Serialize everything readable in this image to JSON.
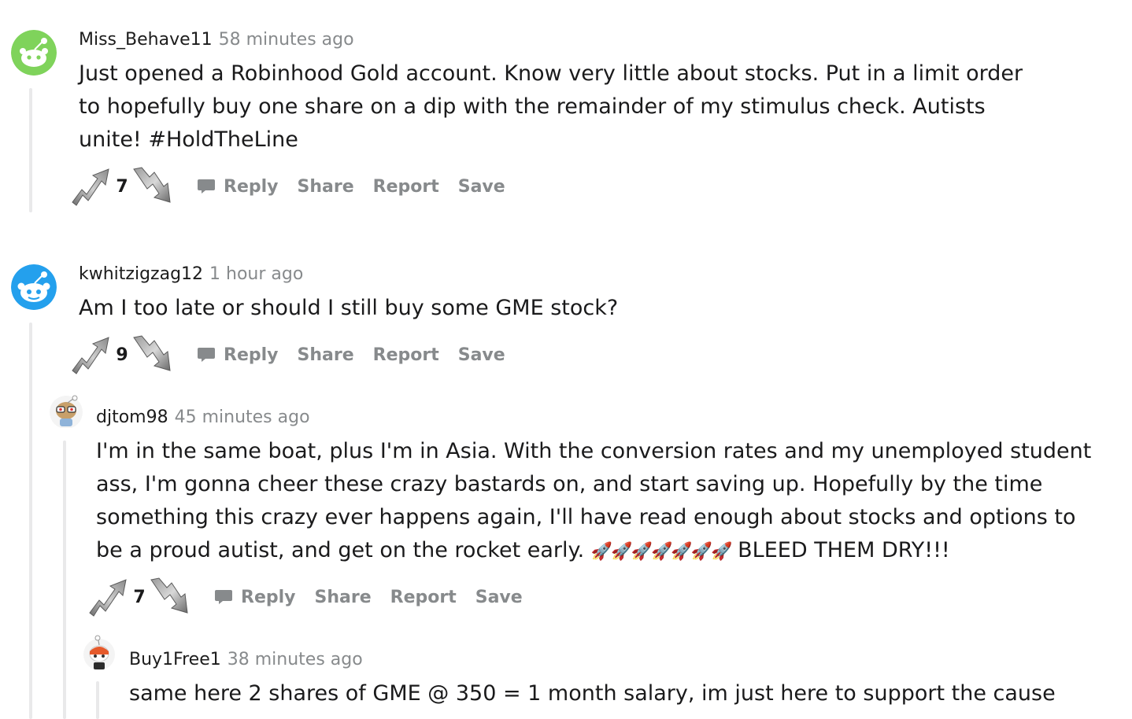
{
  "comments": [
    {
      "username": "Miss_Behave11",
      "time": "58 minutes ago",
      "text": "Just opened a Robinhood Gold account. Know very little about stocks. Put in a limit order to hopefully buy one share on a dip with the remainder of my stimulus check. Autists unite! #HoldTheLine",
      "score": "7",
      "avatar_color": "#7fd35b"
    },
    {
      "username": "kwhitzigzag12",
      "time": "1 hour ago",
      "text": "Am I too late or should I still buy some GME stock?",
      "score": "9",
      "avatar_color": "#24a0ed"
    },
    {
      "username": "djtom98",
      "time": "45 minutes ago",
      "text": "I'm in the same boat, plus I'm in Asia. With the conversion rates and my unemployed student ass, I'm gonna cheer these crazy bastards on, and start saving up. Hopefully by the time something this crazy ever happens again, I'll have read enough about stocks and options to be a proud autist, and get on the rocket early.",
      "emoji": "🚀🚀🚀🚀🚀🚀🚀",
      "text_tail": " BLEED THEM DRY!!!",
      "score": "7",
      "avatar_color": "#c8a06a"
    },
    {
      "username": "Buy1Free1",
      "time": "38 minutes ago",
      "text": "same here 2 shares of GME @ 350 = 1 month salary, im just here to support the cause",
      "avatar_color": "#e55a2b"
    }
  ],
  "actions": {
    "reply": "Reply",
    "share": "Share",
    "report": "Report",
    "save": "Save"
  },
  "icons": {
    "upvote": "upvote-arrow-icon",
    "downvote": "downvote-arrow-icon",
    "reply": "chat-bubble-icon"
  },
  "colors": {
    "meta_gray": "#878a8c",
    "thread_line": "#e9e9ea",
    "text": "#1a1a1b"
  }
}
